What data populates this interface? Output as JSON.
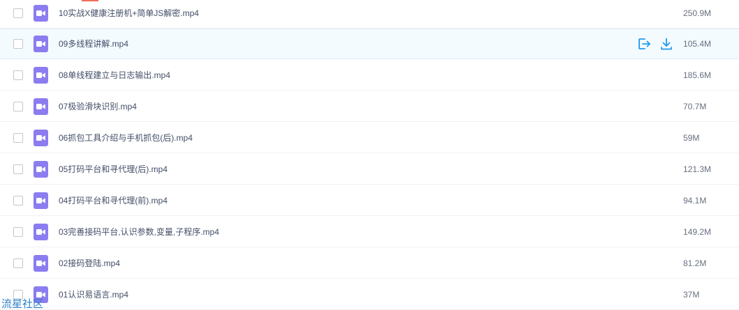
{
  "colors": {
    "video_icon": "#8b7df0",
    "hover_bg": "#f4fbff",
    "action_icon": "#1e9bef",
    "watermark": "#2d7fc7"
  },
  "files": [
    {
      "name": "10实战X健康注册机+简单JS解密.mp4",
      "size": "250.9M",
      "icon": "video-file-icon"
    },
    {
      "name": "09多线程讲解.mp4",
      "size": "105.4M",
      "icon": "video-file-icon",
      "hovered": true
    },
    {
      "name": "08单线程建立与日志输出.mp4",
      "size": "185.6M",
      "icon": "video-file-icon"
    },
    {
      "name": "07极验滑块识别.mp4",
      "size": "70.7M",
      "icon": "video-file-icon"
    },
    {
      "name": "06抓包工具介绍与手机抓包(后).mp4",
      "size": "59M",
      "icon": "video-file-icon"
    },
    {
      "name": "05打码平台和寻代理(后).mp4",
      "size": "121.3M",
      "icon": "video-file-icon"
    },
    {
      "name": "04打码平台和寻代理(前).mp4",
      "size": "94.1M",
      "icon": "video-file-icon"
    },
    {
      "name": "03完善接码平台,认识参数,变量,子程序.mp4",
      "size": "149.2M",
      "icon": "video-file-icon"
    },
    {
      "name": "02接码登陆.mp4",
      "size": "81.2M",
      "icon": "video-file-icon"
    },
    {
      "name": "01认识易语言.mp4",
      "size": "37M",
      "icon": "video-file-icon"
    }
  ],
  "row_actions": [
    {
      "icon": "share-export-icon"
    },
    {
      "icon": "download-icon"
    }
  ],
  "watermark": "流星社区"
}
